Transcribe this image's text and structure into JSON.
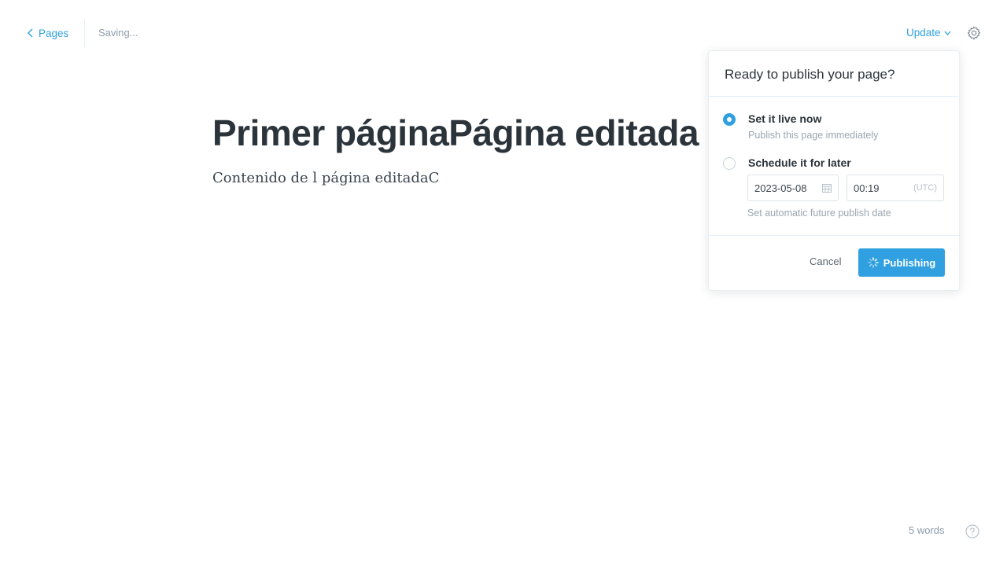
{
  "header": {
    "back_label": "Pages",
    "status": "Saving...",
    "update_label": "Update"
  },
  "editor": {
    "title": "Primer páginaPágina editada",
    "body": "Contenido de l página editadaC"
  },
  "publish_menu": {
    "heading": "Ready to publish your page?",
    "option_now": {
      "label": "Set it live now",
      "description": "Publish this page immediately",
      "selected": true
    },
    "option_schedule": {
      "label": "Schedule it for later",
      "date": "2023-05-08",
      "time": "00:19",
      "timezone": "(UTC)",
      "hint": "Set automatic future publish date",
      "selected": false
    },
    "cancel_label": "Cancel",
    "publish_label": "Publishing"
  },
  "footer": {
    "word_count": "5 words"
  },
  "colors": {
    "accent": "#30a0e0",
    "text_dark": "#2c343b",
    "muted": "#9aa6b0"
  },
  "icons": [
    "chevron-left-icon",
    "chevron-down-icon",
    "gear-icon",
    "calendar-icon",
    "spinner-icon",
    "help-icon"
  ]
}
